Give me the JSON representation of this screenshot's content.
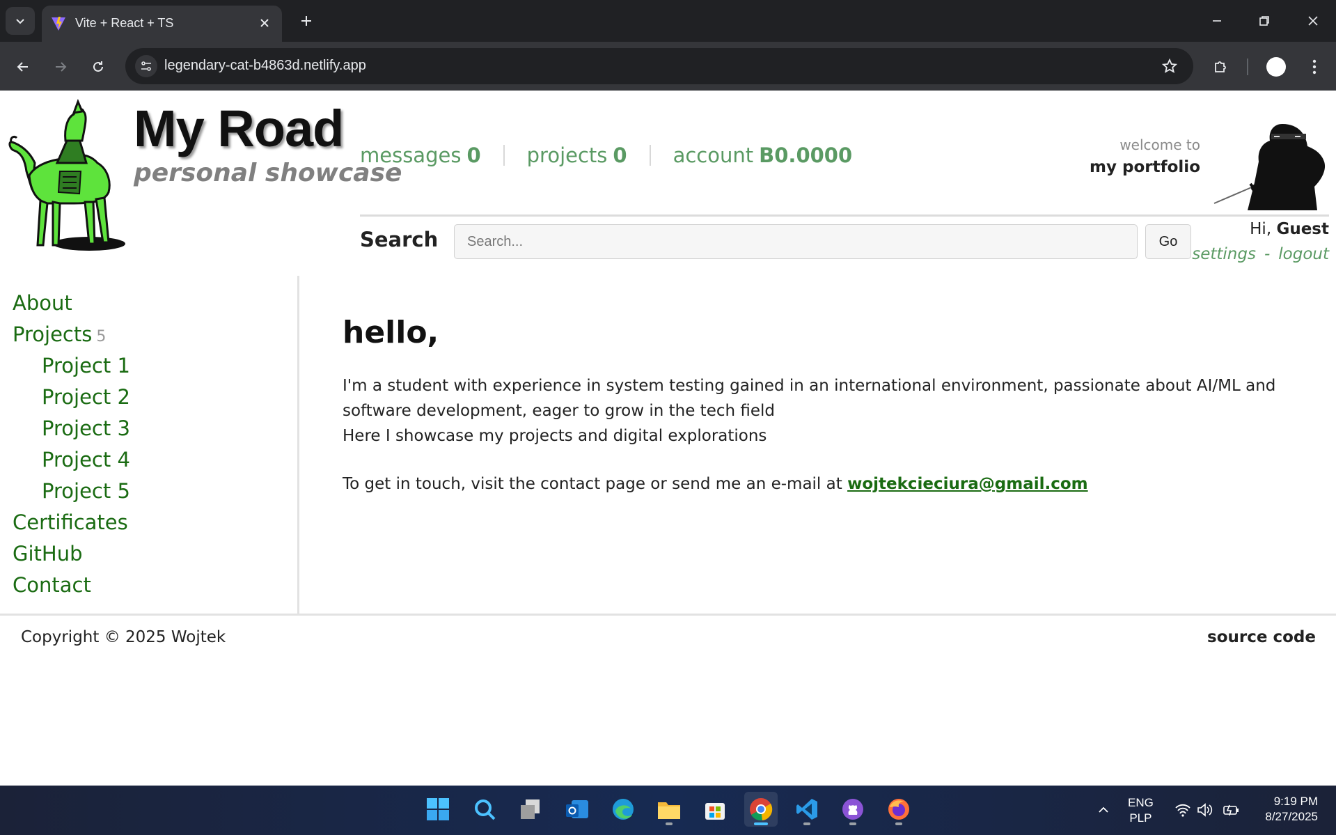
{
  "browser": {
    "tab_title": "Vite + React + TS",
    "url": "legendary-cat-b4863d.netlify.app"
  },
  "header": {
    "title": "My Road",
    "subtitle": "personal showcase",
    "stats": {
      "messages_label": "messages",
      "messages_count": "0",
      "projects_label": "projects",
      "projects_count": "0",
      "account_label": "account",
      "account_value": "B0.0000"
    },
    "welcome_label": "welcome to",
    "welcome_title": "my portfolio",
    "greeting_prefix": "Hi,",
    "user_name": "Guest",
    "settings_link": "settings",
    "link_separator": "-",
    "logout_link": "logout"
  },
  "search": {
    "label": "Search",
    "placeholder": "Search...",
    "button": "Go"
  },
  "sidebar": {
    "items": [
      {
        "label": "About"
      },
      {
        "label": "Projects",
        "count": "5"
      },
      {
        "label": "Project 1"
      },
      {
        "label": "Project 2"
      },
      {
        "label": "Project 3"
      },
      {
        "label": "Project 4"
      },
      {
        "label": "Project 5"
      },
      {
        "label": "Certificates"
      },
      {
        "label": "GitHub"
      },
      {
        "label": "Contact"
      }
    ]
  },
  "main": {
    "heading": "hello,",
    "intro_line1": "I'm a student with experience in system testing gained in an international environment, passionate about AI/ML and software development, eager to grow in the tech field",
    "intro_line2": "Here I showcase my projects and digital explorations",
    "contact_text": "To get in touch, visit the contact page or send me an e-mail at",
    "email": "wojtekcieciura@gmail.com"
  },
  "footer": {
    "copyright": "Copyright © 2025 Wojtek",
    "source_code": "source code"
  },
  "taskbar": {
    "lang_line1": "ENG",
    "lang_line2": "PLP",
    "time": "9:19 PM",
    "date": "8/27/2025"
  },
  "colors": {
    "accent_green": "#1a6b12",
    "stat_green": "#5a9a63",
    "chrome_dark": "#202124",
    "chrome_toolbar": "#35363a"
  }
}
